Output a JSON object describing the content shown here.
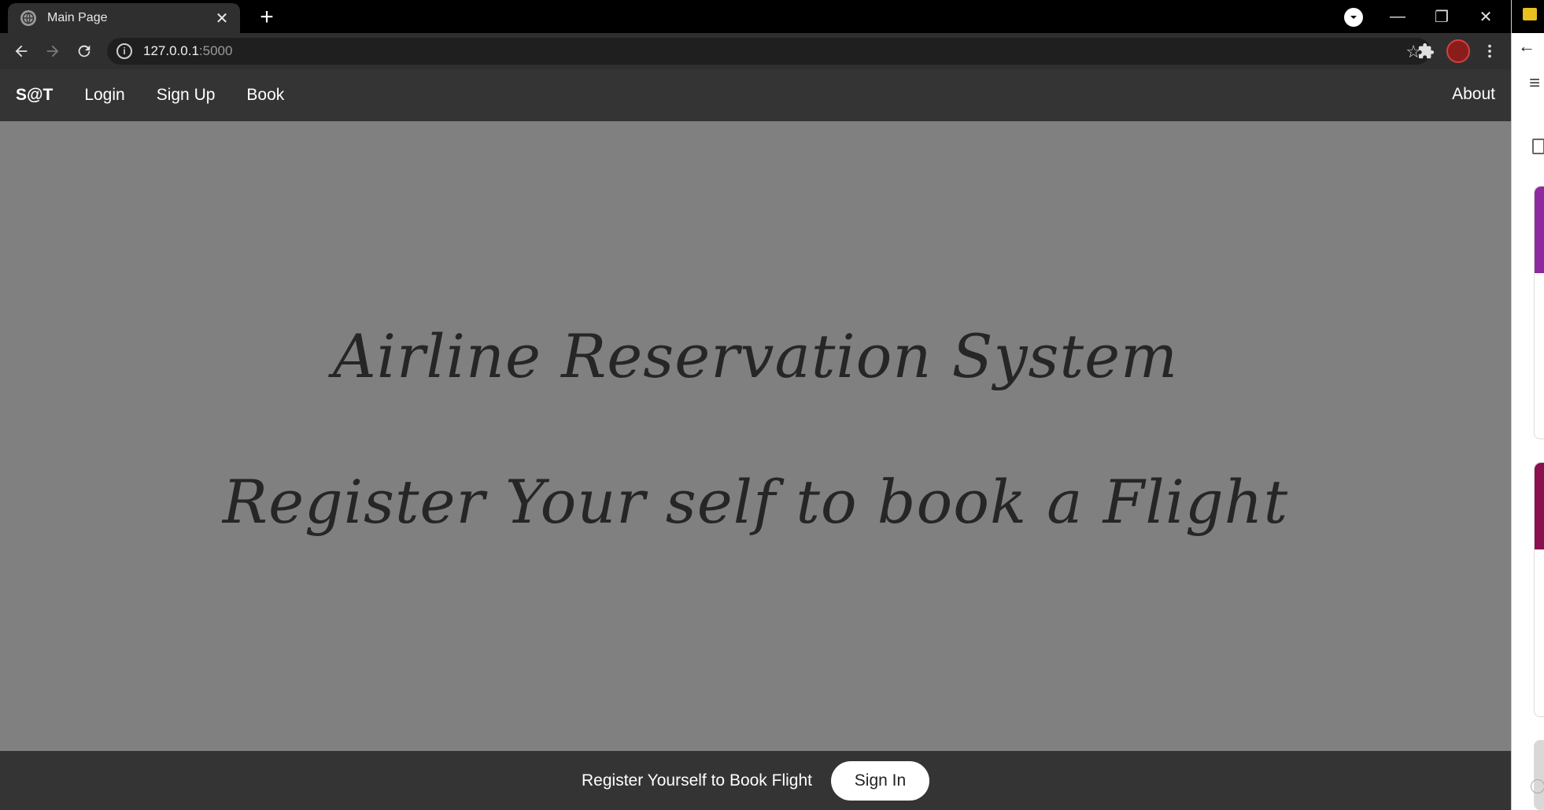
{
  "browser": {
    "tab_title": "Main Page",
    "url_host": "127.0.0.1",
    "url_port": ":5000"
  },
  "navbar": {
    "brand": "S@T",
    "links": [
      "Login",
      "Sign Up",
      "Book"
    ],
    "about": "About"
  },
  "hero": {
    "title": "Airline Reservation System",
    "subtitle": "Register Your self to book a Flight"
  },
  "footer": {
    "message": "Register Yourself to Book Flight",
    "button": "Sign In"
  },
  "colors": {
    "page_bg": "#808080",
    "navbar_bg": "#343434",
    "hero_text": "#262626",
    "card_accent_1": "#8e2aa0",
    "card_accent_2": "#8a1050"
  }
}
